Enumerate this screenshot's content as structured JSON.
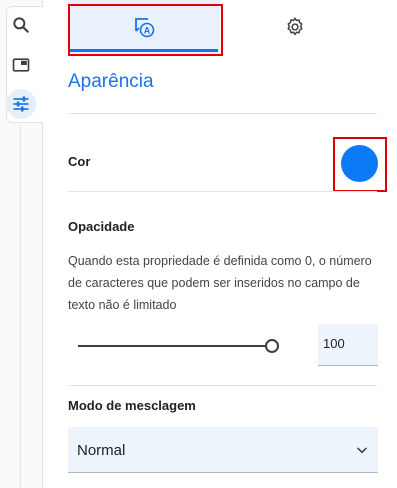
{
  "rail": {
    "items": [
      {
        "icon": "search-icon",
        "active": false
      },
      {
        "icon": "picture-in-picture-icon",
        "active": false
      },
      {
        "icon": "tune-sliders-icon",
        "active": true
      }
    ]
  },
  "tabs": [
    {
      "icon": "appearance-icon",
      "active": true
    },
    {
      "icon": "gear-icon",
      "active": false
    }
  ],
  "panel": {
    "title": "Aparência",
    "color": {
      "label": "Cor",
      "value": "#0a7af5"
    },
    "opacity": {
      "label": "Opacidade",
      "description": "Quando esta propriedade é definida como 0, o número de caracteres que podem ser inseridos no campo de texto não é limitado",
      "value": "100",
      "slider_fraction": 1.0
    },
    "blend": {
      "label": "Modo de mesclagem",
      "selected": "Normal"
    }
  },
  "colors": {
    "accent": "#1a73e8",
    "highlight": "#e00000",
    "field_bg": "#eef4fb"
  }
}
